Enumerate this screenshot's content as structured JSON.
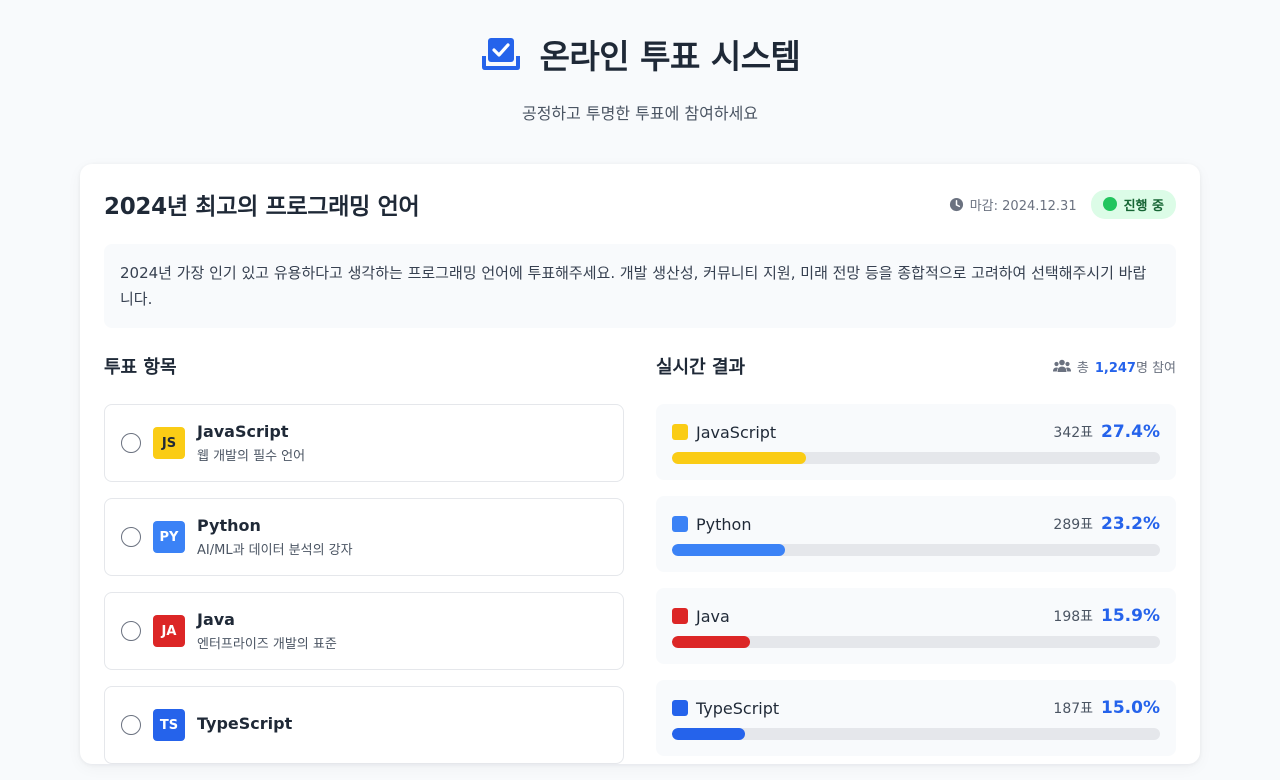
{
  "header": {
    "title": "온라인 투표 시스템",
    "subtitle": "공정하고 투명한 투표에 참여하세요",
    "icon": "ballot-box-icon",
    "accent": "#2563eb"
  },
  "poll": {
    "title": "2024년 최고의 프로그래밍 언어",
    "deadline_label": "마감: 2024.12.31",
    "status": "진행 중",
    "description": "2024년 가장 인기 있고 유용하다고 생각하는 프로그래밍 언어에 투표해주세요. 개발 생산성, 커뮤니티 지원, 미래 전망 등을 종합적으로 고려하여 선택해주시기 바랍니다."
  },
  "options_section": {
    "title": "투표 항목",
    "items": [
      {
        "code": "JS",
        "name": "JavaScript",
        "desc": "웹 개발의 필수 언어",
        "color": "#facc15",
        "text_color": "#1f2937"
      },
      {
        "code": "PY",
        "name": "Python",
        "desc": "AI/ML과 데이터 분석의 강자",
        "color": "#3b82f6",
        "text_color": "#ffffff"
      },
      {
        "code": "JA",
        "name": "Java",
        "desc": "엔터프라이즈 개발의 표준",
        "color": "#dc2626",
        "text_color": "#ffffff"
      },
      {
        "code": "TS",
        "name": "TypeScript",
        "desc": "",
        "color": "#2563eb",
        "text_color": "#ffffff"
      }
    ]
  },
  "results_section": {
    "title": "실시간 결과",
    "participants_prefix": "총",
    "participants_count": "1,247",
    "participants_suffix": "명 참여",
    "items": [
      {
        "name": "JavaScript",
        "votes": "342표",
        "percent_label": "27.4%",
        "percent": 27.4,
        "color": "#facc15"
      },
      {
        "name": "Python",
        "votes": "289표",
        "percent_label": "23.2%",
        "percent": 23.2,
        "color": "#3b82f6"
      },
      {
        "name": "Java",
        "votes": "198표",
        "percent_label": "15.9%",
        "percent": 15.9,
        "color": "#dc2626"
      },
      {
        "name": "TypeScript",
        "votes": "187표",
        "percent_label": "15.0%",
        "percent": 15.0,
        "color": "#2563eb"
      }
    ]
  }
}
